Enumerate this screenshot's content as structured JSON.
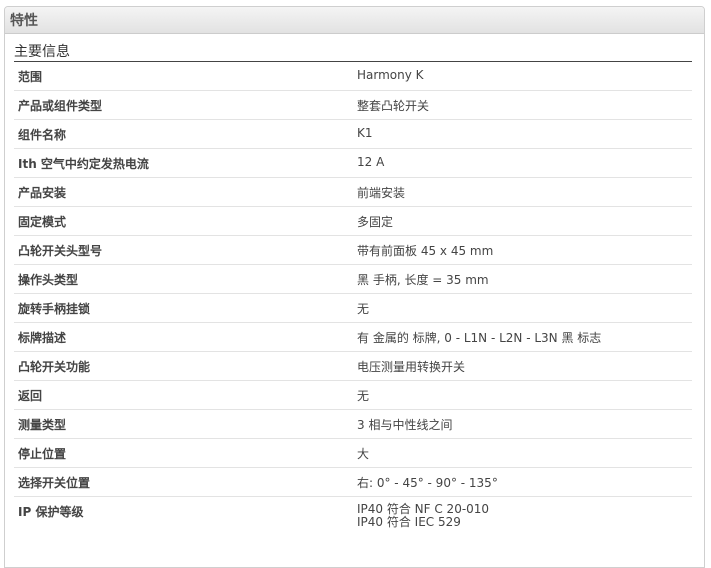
{
  "panel": {
    "title": "特性"
  },
  "section": {
    "title": "主要信息"
  },
  "rows": [
    {
      "label": "范围",
      "value": "Harmony K"
    },
    {
      "label": "产品或组件类型",
      "value": "整套凸轮开关"
    },
    {
      "label": "组件名称",
      "value": "K1"
    },
    {
      "label": "Ith 空气中约定发热电流",
      "value": "12 A"
    },
    {
      "label": "产品安装",
      "value": "前端安装"
    },
    {
      "label": "固定模式",
      "value": "多固定"
    },
    {
      "label": "凸轮开关头型号",
      "value": "带有前面板 45 x 45 mm"
    },
    {
      "label": "操作头类型",
      "value": "黑 手柄, 长度 = 35 mm"
    },
    {
      "label": "旋转手柄挂锁",
      "value": "无"
    },
    {
      "label": "标牌描述",
      "value": "有 金属的 标牌, 0 - L1N - L2N - L3N 黑 标志"
    },
    {
      "label": "凸轮开关功能",
      "value": "电压测量用转换开关"
    },
    {
      "label": "返回",
      "value": "无"
    },
    {
      "label": "测量类型",
      "value": "3 相与中性线之间"
    },
    {
      "label": "停止位置",
      "value": "大"
    },
    {
      "label": "选择开关位置",
      "value": "右: 0° - 45° - 90° - 135°"
    }
  ],
  "last_row": {
    "label": "IP 保护等级",
    "values": [
      "IP40 符合 NF C 20-010",
      "IP40 符合 IEC 529"
    ]
  }
}
